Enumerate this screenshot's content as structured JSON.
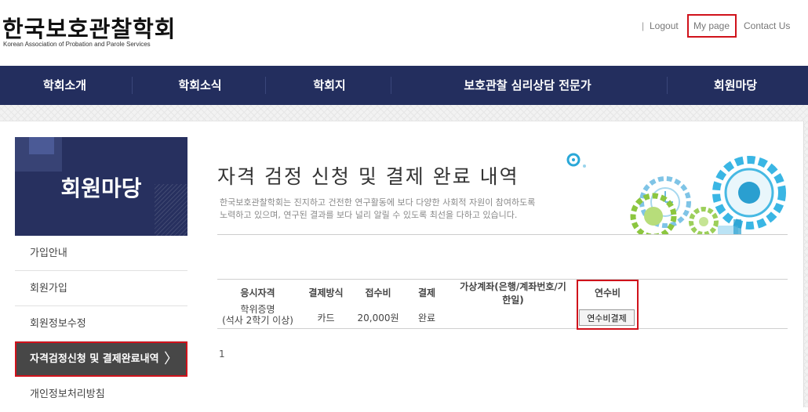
{
  "header": {
    "logo_title": "한국보호관찰학회",
    "logo_subtitle": "Korean Association of Probation and Parole Services",
    "util": {
      "sep": "|",
      "logout": "Logout",
      "mypage": "My page",
      "contact": "Contact Us"
    }
  },
  "gnb": {
    "items": [
      "학회소개",
      "학회소식",
      "학회지",
      "보호관찰 심리상담 전문가",
      "회원마당"
    ]
  },
  "lnb": {
    "title": "회원마당",
    "items": [
      "가입안내",
      "회원가입",
      "회원정보수정",
      "자격검정신청 및 결제완료내역",
      "개인정보처리방침"
    ],
    "active_index": 3,
    "arrow": "〉"
  },
  "page": {
    "title": "자격 검정 신청 및 결제 완료 내역",
    "desc_line1": "한국보호관찰학회는 진지하고 건전한 연구활동에 보다 다양한 사회적 자원이 참여하도록",
    "desc_line2": "노력하고 있으며, 연구된 결과를 보다 널리 알릴 수 있도록 최선을 다하고 있습니다."
  },
  "table": {
    "headers": {
      "qualification": "응시자격",
      "method": "결제방식",
      "fee": "접수비",
      "payment": "결제",
      "account_line1": "가상계좌(은행/계좌번호/기",
      "account_line2": "한일)",
      "training_fee": "연수비"
    },
    "rows": [
      {
        "qualification_line1": "학위증명",
        "qualification_line2": "(석사 2학기 이상)",
        "method": "카드",
        "fee": "20,000원",
        "payment": "완료",
        "account": "",
        "training_button": "연수비결제"
      }
    ]
  },
  "pagination": {
    "current": "1"
  },
  "colors": {
    "nav_bg": "#232e5e",
    "highlight_red": "#d0121b",
    "active_menu_bg": "#474747"
  }
}
